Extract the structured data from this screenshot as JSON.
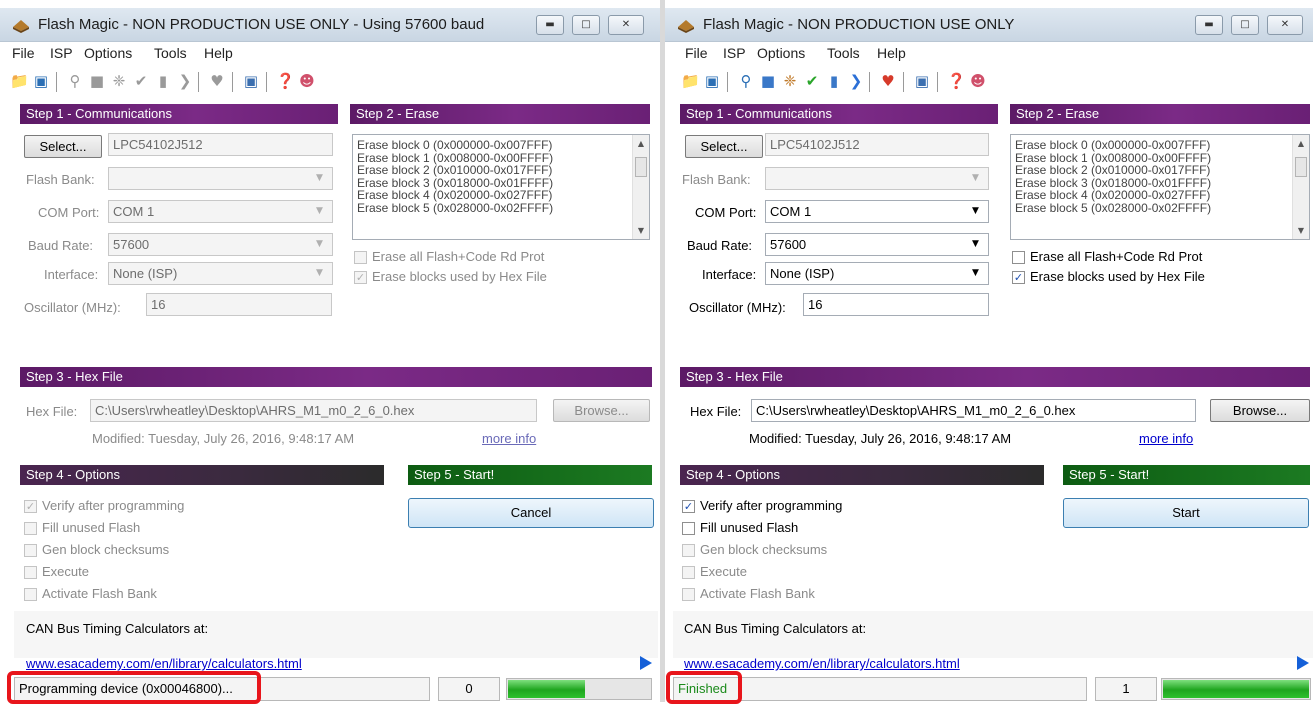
{
  "left": {
    "title": "Flash Magic - NON PRODUCTION USE ONLY - Using 57600 baud",
    "menu": [
      "File",
      "ISP",
      "Options",
      "Tools",
      "Help"
    ],
    "step1": {
      "header": "Step 1 - Communications",
      "select_label": "Select...",
      "device": "LPC54102J512",
      "flash_bank_label": "Flash Bank:",
      "flash_bank_value": "",
      "com_port_label": "COM Port:",
      "com_port_value": "COM 1",
      "baud_rate_label": "Baud Rate:",
      "baud_rate_value": "57600",
      "interface_label": "Interface:",
      "interface_value": "None (ISP)",
      "oscillator_label": "Oscillator (MHz):",
      "oscillator_value": "16"
    },
    "step2": {
      "header": "Step 2 - Erase",
      "blocks": [
        "Erase block 0 (0x000000-0x007FFF)",
        "Erase block 1 (0x008000-0x00FFFF)",
        "Erase block 2 (0x010000-0x017FFF)",
        "Erase block 3 (0x018000-0x01FFFF)",
        "Erase block 4 (0x020000-0x027FFF)",
        "Erase block 5 (0x028000-0x02FFFF)"
      ],
      "erase_all_label": "Erase all Flash+Code Rd Prot",
      "erase_used_label": "Erase blocks used by Hex File"
    },
    "step3": {
      "header": "Step 3 - Hex File",
      "hex_label": "Hex File:",
      "hex_path": "C:\\Users\\rwheatley\\Desktop\\AHRS_M1_m0_2_6_0.hex",
      "browse_label": "Browse...",
      "modified": "Modified: Tuesday, July 26, 2016, 9:48:17 AM",
      "more_info": "more info"
    },
    "step4": {
      "header": "Step 4 - Options",
      "options": [
        "Verify after programming",
        "Fill unused Flash",
        "Gen block checksums",
        "Execute",
        "Activate Flash Bank"
      ]
    },
    "step5": {
      "header": "Step 5 - Start!",
      "button_label": "Cancel"
    },
    "can_text": "CAN Bus Timing Calculators at:",
    "can_link": "www.esacademy.com/en/library/calculators.html",
    "status_text": "Programming device (0x00046800)...",
    "status_count": "0",
    "progress": 0.55
  },
  "right": {
    "title": "Flash Magic - NON PRODUCTION USE ONLY",
    "menu": [
      "File",
      "ISP",
      "Options",
      "Tools",
      "Help"
    ],
    "step1": {
      "header": "Step 1 - Communications",
      "select_label": "Select...",
      "device": "LPC54102J512",
      "flash_bank_label": "Flash Bank:",
      "flash_bank_value": "",
      "com_port_label": "COM Port:",
      "com_port_value": "COM 1",
      "baud_rate_label": "Baud Rate:",
      "baud_rate_value": "57600",
      "interface_label": "Interface:",
      "interface_value": "None (ISP)",
      "oscillator_label": "Oscillator (MHz):",
      "oscillator_value": "16"
    },
    "step2": {
      "header": "Step 2 - Erase",
      "blocks": [
        "Erase block 0 (0x000000-0x007FFF)",
        "Erase block 1 (0x008000-0x00FFFF)",
        "Erase block 2 (0x010000-0x017FFF)",
        "Erase block 3 (0x018000-0x01FFFF)",
        "Erase block 4 (0x020000-0x027FFF)",
        "Erase block 5 (0x028000-0x02FFFF)"
      ],
      "erase_all_label": "Erase all Flash+Code Rd Prot",
      "erase_used_label": "Erase blocks used by Hex File"
    },
    "step3": {
      "header": "Step 3 - Hex File",
      "hex_label": "Hex File:",
      "hex_path": "C:\\Users\\rwheatley\\Desktop\\AHRS_M1_m0_2_6_0.hex",
      "browse_label": "Browse...",
      "modified": "Modified: Tuesday, July 26, 2016, 9:48:17 AM",
      "more_info": "more info"
    },
    "step4": {
      "header": "Step 4 - Options",
      "options": [
        "Verify after programming",
        "Fill unused Flash",
        "Gen block checksums",
        "Execute",
        "Activate Flash Bank"
      ]
    },
    "step5": {
      "header": "Step 5 - Start!",
      "button_label": "Start"
    },
    "can_text": "CAN Bus Timing Calculators at:",
    "can_link": "www.esacademy.com/en/library/calculators.html",
    "status_text": "Finished",
    "status_count": "1",
    "progress": 1.0
  },
  "colors": {
    "step_header": "#6f2479",
    "step5_header": "#1c7a22",
    "highlight": "#e8151b",
    "link": "#0000cc",
    "finished_text": "#1a8a1a"
  },
  "icons": [
    "open-folder-icon",
    "save-icon",
    "search-icon",
    "blank-check-icon",
    "erase-icon",
    "verify-icon",
    "read-icon",
    "go-icon",
    "security-icon",
    "zoom-icon",
    "help-icon",
    "people-icon"
  ]
}
